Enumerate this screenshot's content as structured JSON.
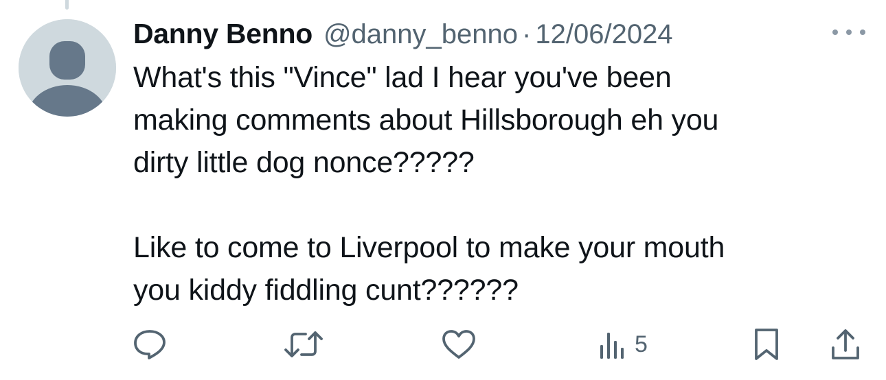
{
  "tweet": {
    "display_name": "Danny Benno",
    "handle": "@danny_benno",
    "separator": "·",
    "date": "12/06/2024",
    "text": "What's this \"Vince\" lad I hear you've been\nmaking comments about Hillsborough eh you\ndirty little dog nonce?????\n\nLike to come to Liverpool to make your mouth\nyou kiddy fiddling cunt??????"
  },
  "actions": {
    "reply_icon": "reply-icon",
    "retweet_icon": "retweet-icon",
    "like_icon": "heart-icon",
    "views_icon": "views-icon",
    "views_count": "5",
    "bookmark_icon": "bookmark-icon",
    "share_icon": "share-icon"
  },
  "colors": {
    "text": "#0f1419",
    "secondary": "#536471",
    "avatar_bg": "#cfd9de",
    "avatar_fg": "#66788a"
  }
}
